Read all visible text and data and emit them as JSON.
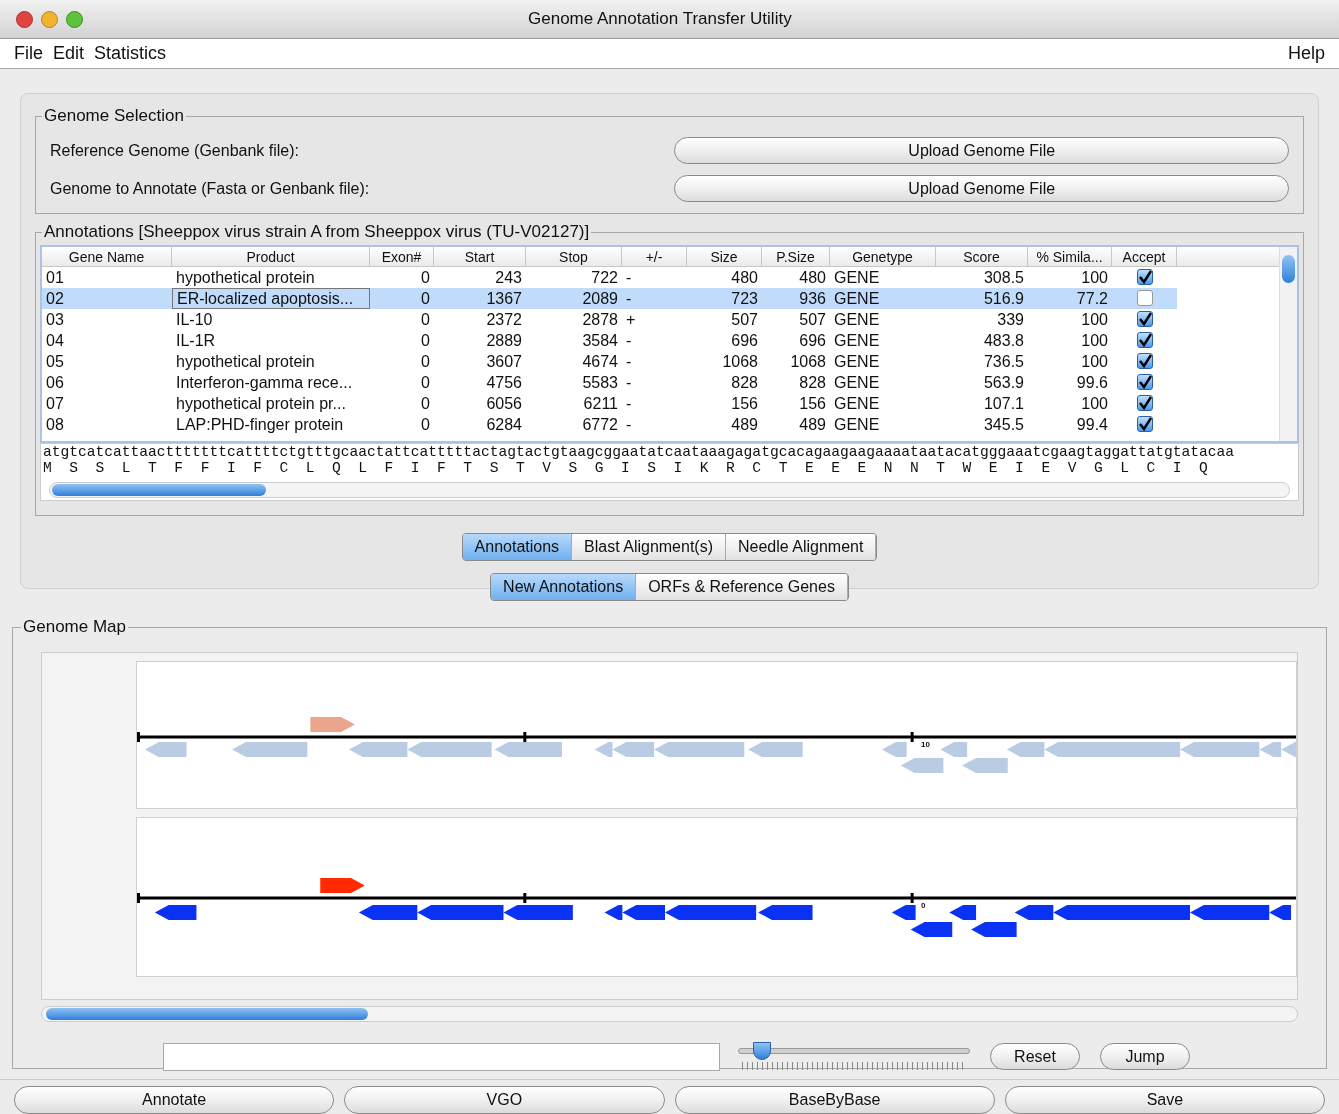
{
  "window": {
    "title": "Genome Annotation Transfer Utility"
  },
  "menu": {
    "left": [
      "File",
      "Edit",
      "Statistics"
    ],
    "right": "Help"
  },
  "genome_selection": {
    "title": "Genome Selection",
    "rows": [
      {
        "label": "Reference Genome (Genbank file):",
        "button": "Upload Genome File"
      },
      {
        "label": "Genome to Annotate (Fasta or Genbank file):",
        "button": "Upload Genome File"
      }
    ]
  },
  "annotations": {
    "title": "Annotations [Sheeppox virus strain A from Sheeppox virus (TU-V02127)]",
    "columns": [
      "Gene Name",
      "Product",
      "Exon#",
      "Start",
      "Stop",
      "+/-",
      "Size",
      "P.Size",
      "Genetype",
      "Score",
      "% Simila...",
      "Accept"
    ],
    "rows": [
      {
        "cells": [
          "01",
          "hypothetical protein",
          "0",
          "243",
          "722",
          "-",
          "480",
          "480",
          "GENE",
          "308.5",
          "100"
        ],
        "accept": true,
        "selected": false
      },
      {
        "cells": [
          "02",
          "ER-localized apoptosis...",
          "0",
          "1367",
          "2089",
          "-",
          "723",
          "936",
          "GENE",
          "516.9",
          "77.2"
        ],
        "accept": false,
        "selected": true
      },
      {
        "cells": [
          "03",
          "IL-10",
          "0",
          "2372",
          "2878",
          "+",
          "507",
          "507",
          "GENE",
          "339",
          "100"
        ],
        "accept": true,
        "selected": false
      },
      {
        "cells": [
          "04",
          "IL-1R",
          "0",
          "2889",
          "3584",
          "-",
          "696",
          "696",
          "GENE",
          "483.8",
          "100"
        ],
        "accept": true,
        "selected": false
      },
      {
        "cells": [
          "05",
          "hypothetical protein",
          "0",
          "3607",
          "4674",
          "-",
          "1068",
          "1068",
          "GENE",
          "736.5",
          "100"
        ],
        "accept": true,
        "selected": false
      },
      {
        "cells": [
          "06",
          "Interferon-gamma rece...",
          "0",
          "4756",
          "5583",
          "-",
          "828",
          "828",
          "GENE",
          "563.9",
          "99.6"
        ],
        "accept": true,
        "selected": false
      },
      {
        "cells": [
          "07",
          "hypothetical protein pr...",
          "0",
          "6056",
          "6211",
          "-",
          "156",
          "156",
          "GENE",
          "107.1",
          "100"
        ],
        "accept": true,
        "selected": false
      },
      {
        "cells": [
          "08",
          "LAP:PHD-finger protein",
          "0",
          "6284",
          "6772",
          "-",
          "489",
          "489",
          "GENE",
          "345.5",
          "99.4"
        ],
        "accept": true,
        "selected": false
      }
    ],
    "dna": "atgtcatcattaactttttttcattttctgtttgcaactattcatttttactagtactgtaagcggaatatcaataaagagatgcacagaagaagaaaataatacatgggaaatcgaagtaggattatgtatacaa",
    "protein": "M  S  S  L  T  F  F  I  F  C  L  Q  L  F  I  F  T  S  T  V  S  G  I  S  I  K  R  C  T  E  E  E  N  N  T  W  E  I  E  V  G  L  C  I  Q"
  },
  "view_tabs": [
    {
      "label": "Annotations",
      "selected": true
    },
    {
      "label": "Blast Alignment(s)",
      "selected": false
    },
    {
      "label": "Needle Alignment",
      "selected": false
    }
  ],
  "map_tabs": [
    {
      "label": "New Annotations",
      "selected": true
    },
    {
      "label": "ORFs & Reference Genes",
      "selected": false
    }
  ],
  "genome_map": {
    "title": "Genome Map",
    "tracks": [
      {
        "tick_label": "10"
      },
      {
        "tick_label": "0"
      }
    ]
  },
  "navigation": {
    "zoom": {
      "level": 0.06
    },
    "buttons": [
      "Reset",
      "Jump"
    ]
  },
  "bottom_buttons": [
    "Annotate",
    "VGO",
    "BaseByBase",
    "Save"
  ]
}
